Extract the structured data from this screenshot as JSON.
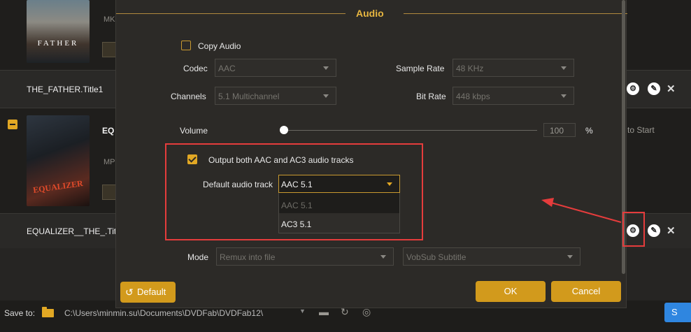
{
  "background": {
    "movie1": {
      "poster_text": "FATHER",
      "format": "MK",
      "title_row": "THE_FATHER.Title1"
    },
    "movie2": {
      "poster_text": "EQUALIZER",
      "name_partial": "EQ",
      "format": "MP",
      "title_row": "EQUALIZER__THE_.Title"
    },
    "start_text": "to Start"
  },
  "dialog": {
    "section_title": "Audio",
    "copy_audio_label": "Copy Audio",
    "codec": {
      "label": "Codec",
      "value": "AAC"
    },
    "sample_rate": {
      "label": "Sample Rate",
      "value": "48 KHz"
    },
    "channels": {
      "label": "Channels",
      "value": "5.1 Multichannel"
    },
    "bit_rate": {
      "label": "Bit Rate",
      "value": "448 kbps"
    },
    "volume": {
      "label": "Volume",
      "value": "100",
      "unit": "%",
      "level": 0
    },
    "output_both_label": "Output both AAC and AC3 audio tracks",
    "default_audio_track": {
      "label": "Default audio track",
      "selected": "AAC 5.1",
      "options": [
        "AAC 5.1",
        "AC3 5.1"
      ]
    },
    "mode": {
      "label": "Mode",
      "value": "Remux into file"
    },
    "subtitle": {
      "value": "VobSub Subtitle"
    },
    "buttons": {
      "default": "Default",
      "ok": "OK",
      "cancel": "Cancel"
    }
  },
  "save_bar": {
    "label": "Save to:",
    "path": "C:\\Users\\minmin.su\\Documents\\DVDFab\\DVDFab12\\",
    "start_button": "S"
  },
  "colors": {
    "accent": "#e2a824",
    "highlight": "#e53c3c",
    "button": "#d29a1c"
  }
}
